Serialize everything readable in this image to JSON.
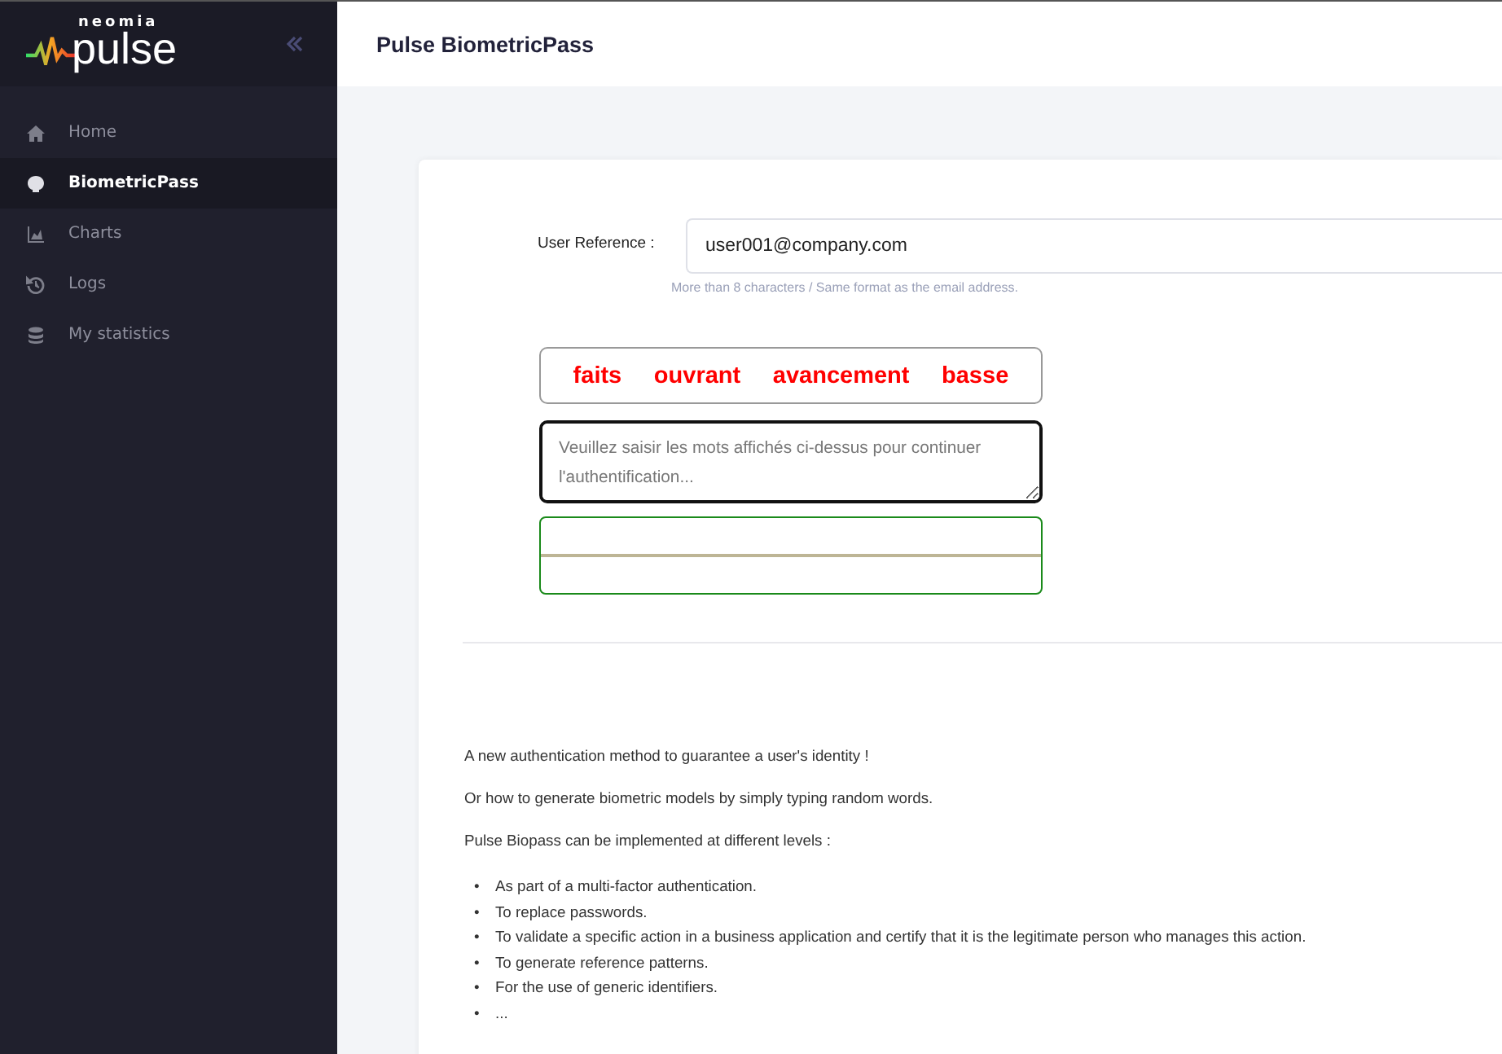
{
  "logo": {
    "small": "neomia",
    "large": "pulse"
  },
  "sidebar": {
    "items": [
      {
        "label": "Home",
        "selected": false
      },
      {
        "label": "BiometricPass",
        "selected": true
      },
      {
        "label": "Charts",
        "selected": false
      },
      {
        "label": "Logs",
        "selected": false
      },
      {
        "label": "My statistics",
        "selected": false
      }
    ]
  },
  "header": {
    "title": "Pulse BiometricPass"
  },
  "form": {
    "user_reference": {
      "label": "User Reference :",
      "value": "user001@company.com",
      "hint": "More than 8 characters / Same format as the email address."
    },
    "words": [
      "faits",
      "ouvrant",
      "avancement",
      "basse"
    ],
    "typing": {
      "placeholder": "Veuillez saisir les mots affichés ci-dessus pour continuer l'authentification..."
    }
  },
  "description": {
    "paragraphs": [
      "A new authentication method to guarantee a user's identity !",
      "Or how to generate biometric models by simply typing random words.",
      "Pulse Biopass can be implemented at different levels :"
    ],
    "bullets": [
      {
        "marker": "•",
        "text": "As part of a multi-factor authentication."
      },
      {
        "marker": "•",
        "text": "To replace passwords."
      },
      {
        "marker": "•",
        "text": "To validate a specific action in a business application and certify that it is the legitimate person who manages this action."
      },
      {
        "marker": "•",
        "text": "To generate reference patterns."
      },
      {
        "marker": "•",
        "text": "For the use of generic identifiers."
      },
      {
        "marker": "•",
        "text": "..."
      }
    ]
  }
}
